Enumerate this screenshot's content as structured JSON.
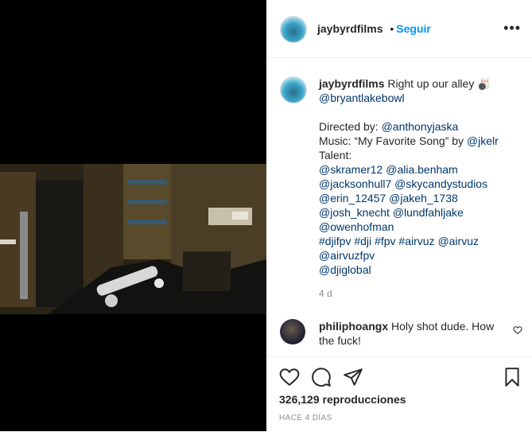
{
  "post": {
    "author": "jaybyrdfilms",
    "follow_label": "Seguir",
    "separator": "•",
    "more_label": "•••"
  },
  "caption": {
    "author": "jaybyrdfilms",
    "line1": " Right up our alley 🎳",
    "mention_bowl": "@bryantlakebowl",
    "directed_prefix": "Directed by: ",
    "director": "@anthonyjaska",
    "music_prefix": "Music: “My Favorite Song” by ",
    "music_artist": "@jkelr",
    "talent_label": "Talent:",
    "talent_1a": "@skramer12",
    "talent_1b": "@alia.benham",
    "talent_2a": "@jacksonhull7",
    "talent_2b": "@skycandystudios",
    "talent_3a": "@erin_12457",
    "talent_3b": "@jakeh_1738",
    "talent_4a": "@josh_knecht",
    "talent_4b": "@lundfahljake",
    "talent_5": "@owenhofman",
    "h1": "#djifpv",
    "h2": "#dji",
    "h3": "#fpv",
    "h4": "#airvuz",
    "h5": "@airvuz",
    "h6": "@airvuzfpv",
    "h7": "@djiglobal",
    "time": "4 d"
  },
  "comment": {
    "author": "philiphoangx",
    "text": " Holy shot dude. How the fuck!"
  },
  "footer": {
    "views": "326,129 reproducciones",
    "ago": "HACE 4 DÍAS"
  }
}
